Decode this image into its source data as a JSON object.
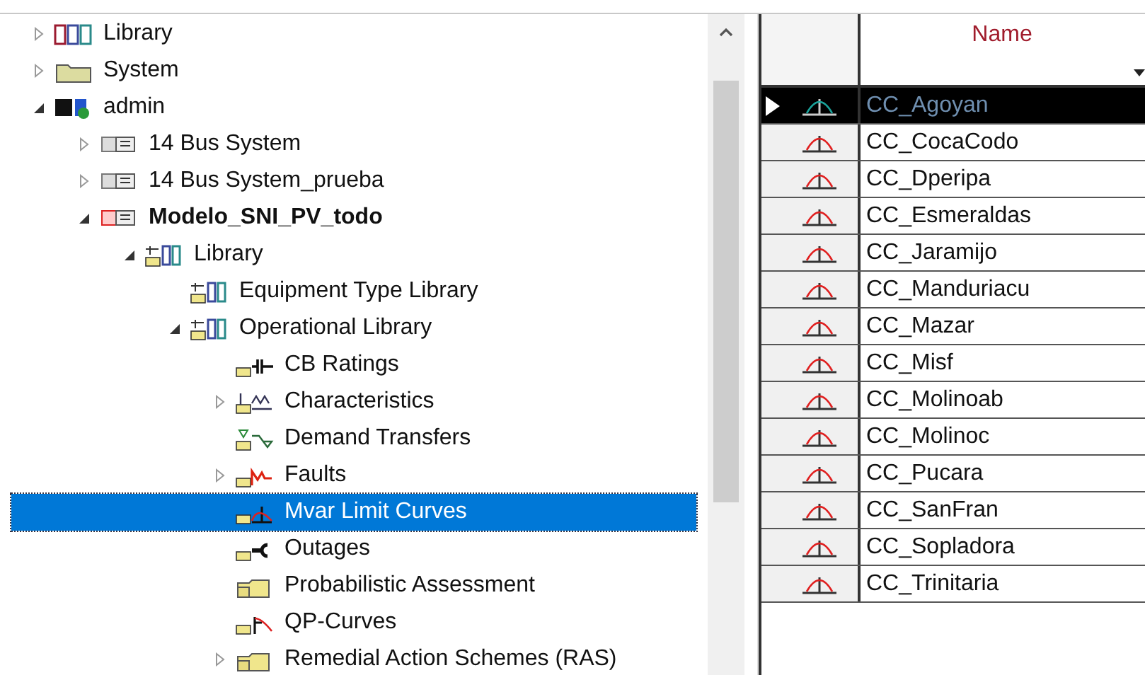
{
  "tree": [
    {
      "label": "Library",
      "kind": "library",
      "expanded": false,
      "selected": false
    },
    {
      "label": "System",
      "kind": "folder",
      "expanded": false,
      "selected": false
    },
    {
      "label": "admin",
      "kind": "user",
      "expanded": true,
      "selected": false,
      "children": [
        {
          "label": "14 Bus System",
          "kind": "project",
          "active": false,
          "expanded": false,
          "selected": false
        },
        {
          "label": "14 Bus System_prueba",
          "kind": "project",
          "active": false,
          "expanded": false,
          "selected": false
        },
        {
          "label": "Modelo_SNI_PV_todo",
          "kind": "project",
          "active": true,
          "expanded": true,
          "selected": false,
          "children": [
            {
              "label": "Library",
              "kind": "library-folder",
              "expanded": true,
              "selected": false,
              "children": [
                {
                  "label": "Equipment Type Library",
                  "kind": "library-folder",
                  "selected": false
                },
                {
                  "label": "Operational Library",
                  "kind": "library-folder",
                  "expanded": true,
                  "selected": false,
                  "children": [
                    {
                      "label": "CB Ratings",
                      "kind": "breaker-folder",
                      "selected": false
                    },
                    {
                      "label": "Characteristics",
                      "kind": "characteristic-folder",
                      "expanded": false,
                      "selected": false
                    },
                    {
                      "label": "Demand Transfers",
                      "kind": "transfer-folder",
                      "selected": false
                    },
                    {
                      "label": "Faults",
                      "kind": "fault-folder",
                      "expanded": false,
                      "selected": false
                    },
                    {
                      "label": "Mvar Limit Curves",
                      "kind": "curve-folder",
                      "selected": true
                    },
                    {
                      "label": "Outages",
                      "kind": "outage-folder",
                      "selected": false
                    },
                    {
                      "label": "Probabilistic Assessment",
                      "kind": "plain-folder",
                      "selected": false
                    },
                    {
                      "label": "QP-Curves",
                      "kind": "qp-folder",
                      "selected": false
                    },
                    {
                      "label": "Remedial Action Schemes (RAS)",
                      "kind": "plain-folder",
                      "expanded": false,
                      "selected": false
                    }
                  ]
                }
              ]
            }
          ]
        }
      ]
    }
  ],
  "table": {
    "columns": [
      "Name"
    ],
    "rows": [
      {
        "name": "CC_Agoyan",
        "selected": true
      },
      {
        "name": "CC_CocaCodo",
        "selected": false
      },
      {
        "name": "CC_Dperipa",
        "selected": false
      },
      {
        "name": "CC_Esmeraldas",
        "selected": false
      },
      {
        "name": "CC_Jaramijo",
        "selected": false
      },
      {
        "name": "CC_Manduriacu",
        "selected": false
      },
      {
        "name": "CC_Mazar",
        "selected": false
      },
      {
        "name": "CC_Misf",
        "selected": false
      },
      {
        "name": "CC_Molinoab",
        "selected": false
      },
      {
        "name": "CC_Molinoc",
        "selected": false
      },
      {
        "name": "CC_Pucara",
        "selected": false
      },
      {
        "name": "CC_SanFran",
        "selected": false
      },
      {
        "name": "CC_Sopladora",
        "selected": false
      },
      {
        "name": "CC_Trinitaria",
        "selected": false
      }
    ]
  }
}
